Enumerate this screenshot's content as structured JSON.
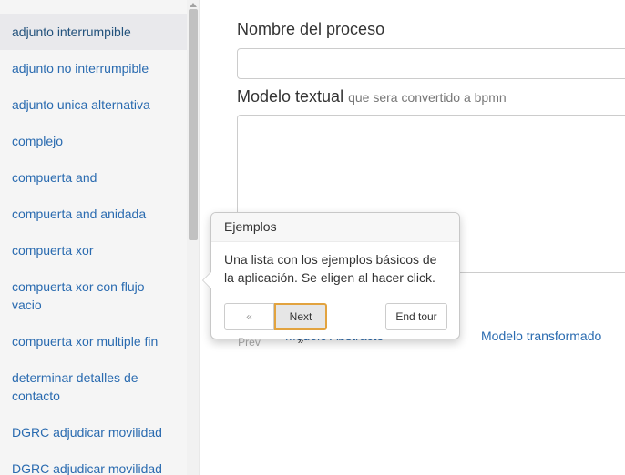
{
  "sidebar": {
    "items": [
      {
        "label": "adjunto interrumpible",
        "active": true
      },
      {
        "label": "adjunto no interrumpible"
      },
      {
        "label": "adjunto unica alternativa"
      },
      {
        "label": "complejo"
      },
      {
        "label": "compuerta and"
      },
      {
        "label": "compuerta and anidada"
      },
      {
        "label": "compuerta xor"
      },
      {
        "label": "compuerta xor con flujo vacio"
      },
      {
        "label": "compuerta xor multiple fin"
      },
      {
        "label": "determinar detalles de contacto"
      },
      {
        "label": "DGRC adjudicar movilidad"
      },
      {
        "label": "DGRC adjudicar movilidad"
      }
    ]
  },
  "form": {
    "name_label": "Nombre del proceso",
    "name_value": "",
    "model_label": "Modelo textual",
    "model_hint": "que sera convertido a bpmn",
    "model_value": ""
  },
  "links": {
    "abstract": "Modelo Abstracto",
    "transformed": "Modelo transformado"
  },
  "tour": {
    "title": "Ejemplos",
    "content": "Una lista con los ejemplos básicos de la aplicación. Se eligen al hacer click.",
    "prev": "« Prev",
    "next": "Next »",
    "end": "End tour"
  },
  "colors": {
    "link": "#2a6bb0",
    "sidebar_bg": "#f5f5f5",
    "focus_border": "#e2a33f"
  }
}
